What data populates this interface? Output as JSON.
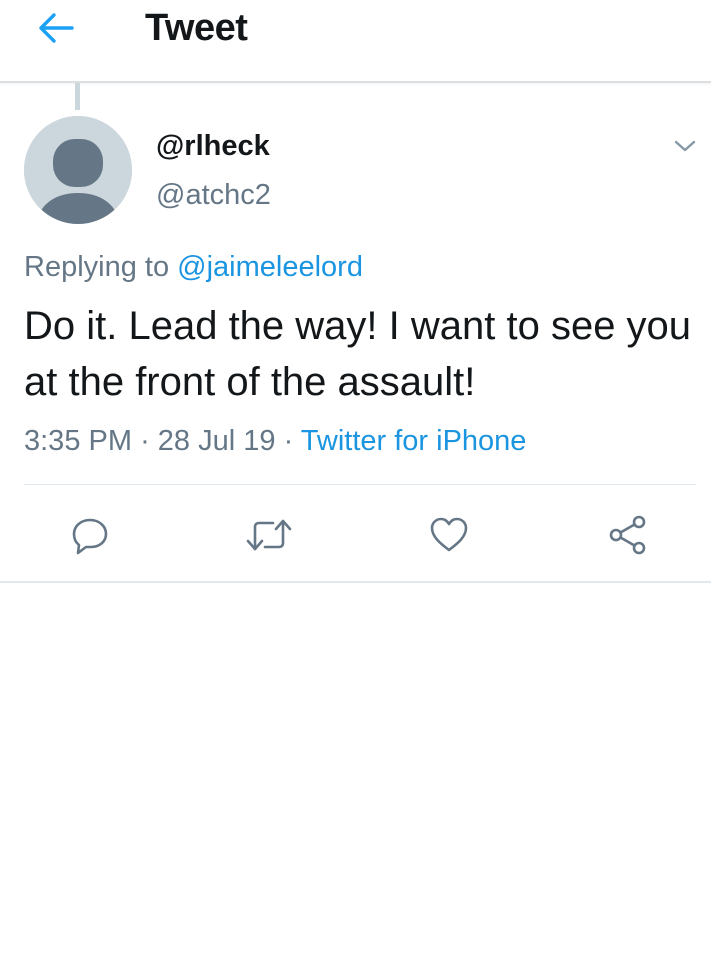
{
  "header": {
    "title": "Tweet",
    "back_icon": "arrow-left-icon",
    "accent_color": "#1da1f2"
  },
  "tweet": {
    "display_name": "@rlheck",
    "handle": "@atchc2",
    "avatar_icon": "default-profile-silhouette",
    "menu_icon": "chevron-down-icon",
    "replying_prefix": "Replying to",
    "replying_to": "@jaimeleelord",
    "text": "Do it. Lead the way! I want to see you at the front of the assault!",
    "time": "3:35 PM",
    "separator": "·",
    "date": "28 Jul 19",
    "source": "Twitter for iPhone"
  },
  "actions": [
    {
      "icon": "reply-icon"
    },
    {
      "icon": "retweet-icon"
    },
    {
      "icon": "like-icon"
    },
    {
      "icon": "share-icon"
    }
  ],
  "colors": {
    "text": "#14171a",
    "secondary": "#657786",
    "link": "#1b95e0",
    "divider": "#e1e8ed"
  }
}
